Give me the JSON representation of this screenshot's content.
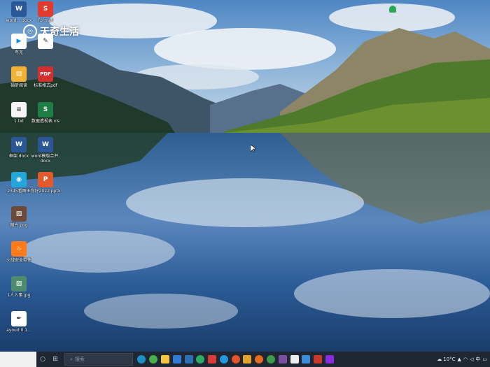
{
  "watermark": {
    "text": "天奇生活"
  },
  "desktop": {
    "icons": [
      {
        "label": "word...\ndocx",
        "color": "#2b5797",
        "glyph": "W"
      },
      {
        "label": "Formall",
        "color": "#e23b2e",
        "glyph": "S"
      },
      {
        "label": "夸克",
        "color": "#ffffff",
        "glyph": "▶"
      },
      {
        "label": "",
        "color": "#ffffff",
        "glyph": "✎"
      },
      {
        "label": "福昕阅读",
        "color": "#f2b233",
        "glyph": "▤"
      },
      {
        "label": "标准格式pdf",
        "color": "#d32f2f",
        "glyph": "PDF"
      },
      {
        "label": "1.txt",
        "color": "#f5f5f5",
        "glyph": "≡"
      },
      {
        "label": "数据透视表.xls",
        "color": "#1e7e45",
        "glyph": "S"
      },
      {
        "label": "框架.docx",
        "color": "#2b5797",
        "glyph": "W"
      },
      {
        "label": "word模版合并.docx",
        "color": "#2b5797",
        "glyph": "W"
      },
      {
        "label": "2345看图王",
        "color": "#23a6d9",
        "glyph": "◉"
      },
      {
        "label": "你好2022.pptx",
        "color": "#e05a2b",
        "glyph": "P"
      },
      {
        "label": "图片.png",
        "color": "#6b4a3a",
        "glyph": "▨"
      },
      {
        "label": "火绒安全软件",
        "color": "#ff7a1a",
        "glyph": "🔥"
      },
      {
        "label": "1人入事.jpg",
        "color": "#4f8a6e",
        "glyph": "▨"
      },
      {
        "label": "ayoud 0.1...",
        "color": "#ffffff",
        "glyph": "✒"
      }
    ]
  },
  "taskbar": {
    "search_placeholder": "搜索",
    "apps": [
      {
        "name": "edge",
        "color": "#1e90c7"
      },
      {
        "name": "360",
        "color": "#48b04a"
      },
      {
        "name": "files",
        "color": "#f5c542"
      },
      {
        "name": "store",
        "color": "#2f7bd6"
      },
      {
        "name": "photoshop",
        "color": "#2d6fb3"
      },
      {
        "name": "wechat",
        "color": "#2aae67"
      },
      {
        "name": "wps",
        "color": "#d93a3a"
      },
      {
        "name": "qq",
        "color": "#2299dd"
      },
      {
        "name": "browser",
        "color": "#e5552b"
      },
      {
        "name": "folder",
        "color": "#e0a32c"
      },
      {
        "name": "firefox",
        "color": "#e66b1c"
      },
      {
        "name": "chrome",
        "color": "#3b9c4b"
      },
      {
        "name": "pr",
        "color": "#7b4fa0"
      },
      {
        "name": "app",
        "color": "#eeeeee"
      },
      {
        "name": "video",
        "color": "#3a8ed8"
      },
      {
        "name": "office",
        "color": "#c93a2e"
      },
      {
        "name": "pr2",
        "color": "#8a2be2"
      }
    ],
    "weather": "10°C"
  }
}
